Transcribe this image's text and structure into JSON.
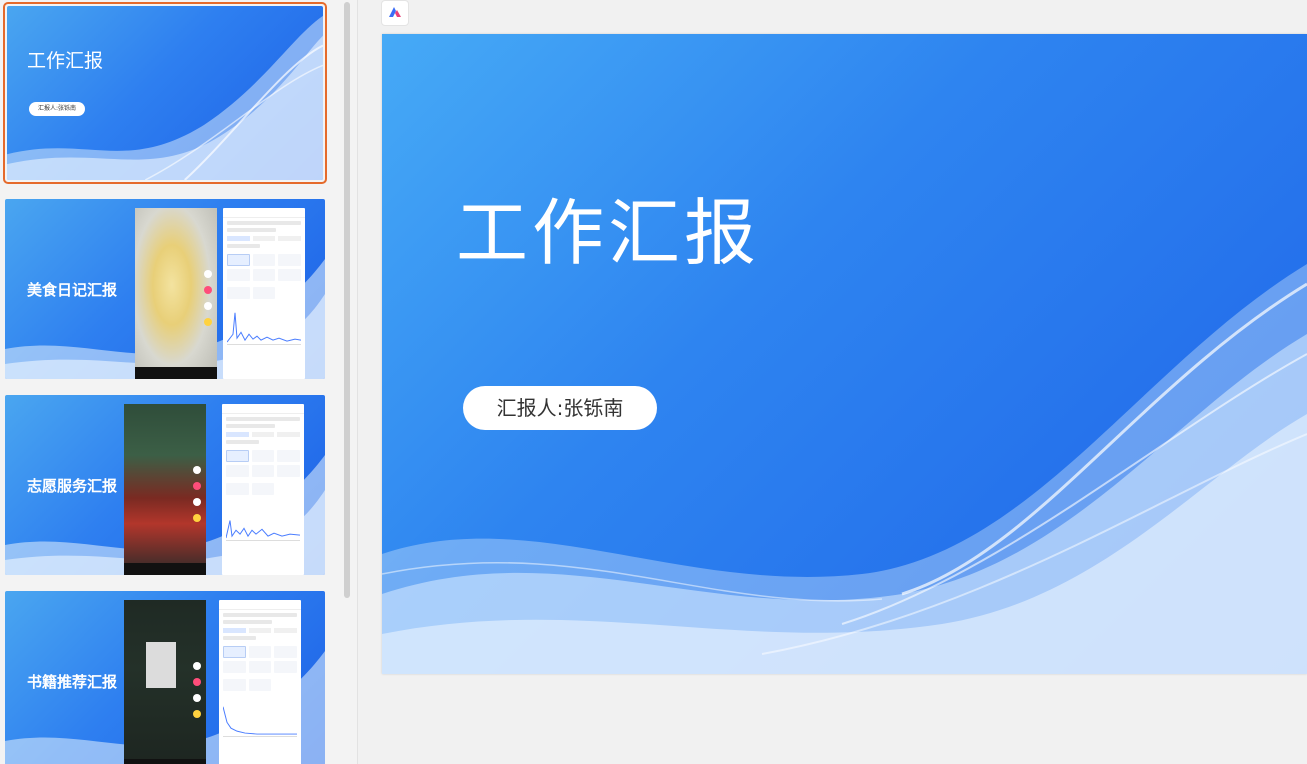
{
  "app": {
    "button_icon": "app-logo-icon"
  },
  "sidebar": {
    "slides": [
      {
        "title": "工作汇报",
        "subtitle": "汇报人:张铄南",
        "selected": true
      },
      {
        "title": "美食日记汇报",
        "selected": false
      },
      {
        "title": "志愿服务汇报",
        "selected": false
      },
      {
        "title": "书籍推荐汇报",
        "selected": false
      }
    ]
  },
  "main": {
    "title": "工作汇报",
    "presenter": "汇报人:张铄南"
  },
  "colors": {
    "selection_border": "#e56a2b",
    "slide_blue": "#2e7ff0"
  }
}
